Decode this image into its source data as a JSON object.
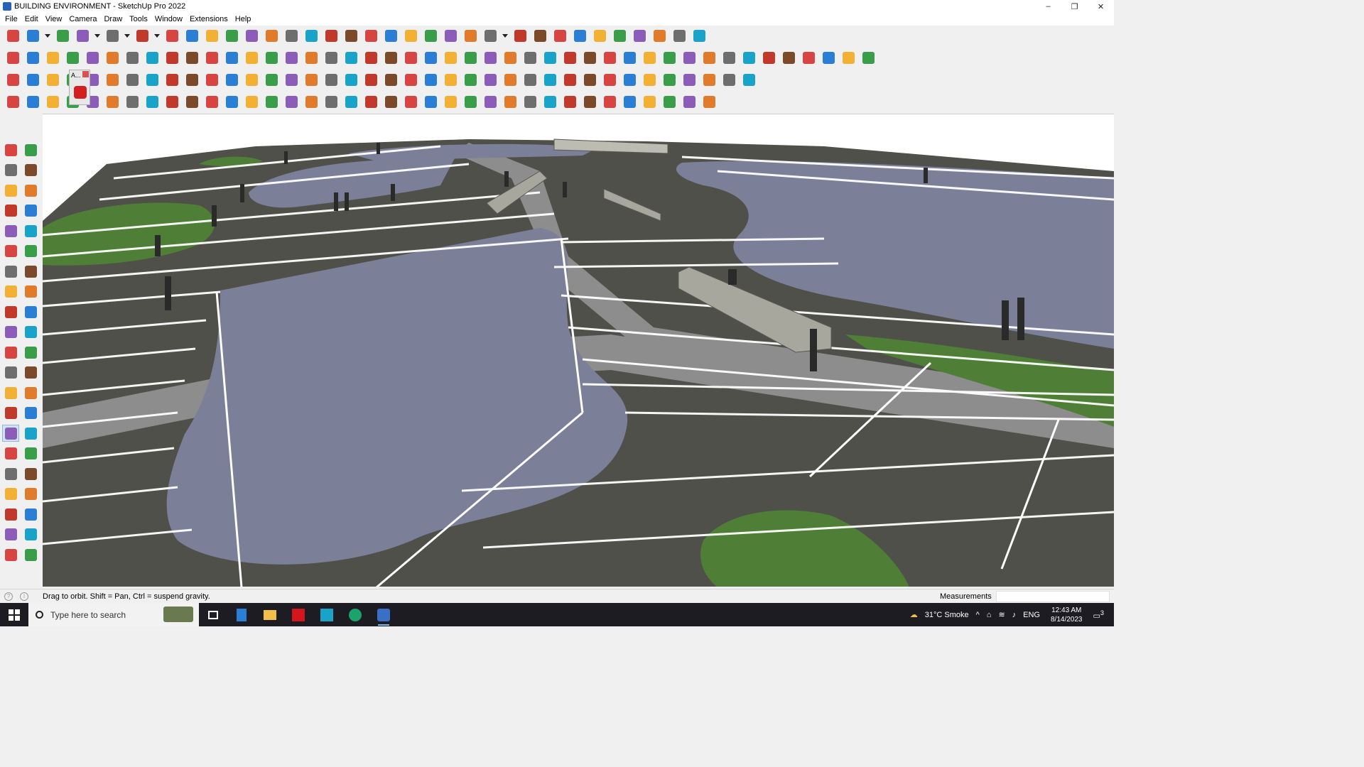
{
  "window": {
    "title": "BUILDING ENVIRONMENT - SketchUp Pro 2022",
    "minimize": "–",
    "restore": "❐",
    "close": "✕"
  },
  "menu": [
    "File",
    "Edit",
    "View",
    "Camera",
    "Draw",
    "Tools",
    "Window",
    "Extensions",
    "Help"
  ],
  "toolbars": {
    "row1_icons": [
      "zoom-tool",
      "select-tool",
      "dropdown",
      "eraser-tool",
      "pencil-line-tool",
      "dropdown",
      "freehand-tool",
      "dropdown",
      "rectangle-tool",
      "dropdown",
      "push-pull-tool",
      "follow-me-tool",
      "move-tool",
      "rotate-tool",
      "scale-tool",
      "tape-measure-tool",
      "text-tool",
      "paint-bucket-tool",
      "orbit-tool",
      "pan-tool",
      "zoom-tool",
      "zoom-extents-tool",
      "sandbox-from-contours",
      "sandbox-smoove",
      "sandbox-stamp",
      "sandbox-drape",
      "styles-tool",
      "dropdown",
      "component-tool",
      "group-tool",
      "axis-tool",
      "move-up",
      "move-down",
      "dimension-tool",
      "section-plane",
      "undo",
      "redo",
      "extension-tool"
    ],
    "row2_icons": [
      "iso-view",
      "top-view",
      "front-view",
      "push-pull-red",
      "arrow-down",
      "arrow-down-blue",
      "arrow-down-r",
      "arrow-down-v",
      "arrow-down-n",
      "arrow-down-x",
      "arrow-down-f",
      "curve-tool",
      "section-cut-1",
      "section-cut-2",
      "section-cut-3",
      "terrain-tool",
      "terrain-drape",
      "house-3d",
      "door-tool",
      "house-outline",
      "window-tool",
      "roof-tool",
      "font-tool",
      "eraser-soft",
      "pencil-red",
      "shape-rect",
      "shape-circle",
      "shape-hexagon",
      "shape-ellipse",
      "shape-parallelogram",
      "shape-arc",
      "shape-freehand",
      "shape-lasso",
      "shape-cloud",
      "shape-spiral",
      "laser-tool",
      "brush-tool",
      "material-a",
      "material-b",
      "material-c",
      "material-d",
      "material-e",
      "material-f",
      "material-g"
    ],
    "row3_icons": [
      "layers-blue",
      "layers-cyan",
      "layers-yellow",
      "tag-tool",
      "plane-tool",
      "rotate-orange",
      "square-red",
      "frame-tool",
      "bookmark-tool",
      "box-tool",
      "link-tool",
      "arc-tool",
      "dotted-line",
      "plus-red",
      "plus-green",
      "cross-blue",
      "cone-tool",
      "bucket-tool",
      "triangle-tool",
      "curve-yellow",
      "spiral-tool",
      "loop-tool",
      "move-blue",
      "box-brown",
      "magnet-tool",
      "grid-green",
      "paint-tool",
      "merge-tool",
      "explode-tool",
      "gem-tool",
      "cube-array",
      "box-flat",
      "grid-orange",
      "grid-square",
      "grid-dense",
      "dots-red",
      "curve-dots",
      "array-tool"
    ],
    "row4_icons": [
      "smart-select",
      "dashed-curve",
      "paint-red",
      "outline-tool",
      "tube-tool",
      "sweep-tool",
      "box-outline",
      "globe-tool",
      "bend-tool",
      "corner-1",
      "corner-2",
      "angle-tool",
      "fillet-tool",
      "building-tool",
      "slice-tool",
      "column-tool",
      "fan-tool",
      "hand-tool",
      "extrude-tool",
      "pyramid-tool",
      "stack-tool",
      "hatch-1",
      "hatch-2",
      "hatch-3",
      "block-tool",
      "hatch-4",
      "cube-flip",
      "mesh-tool",
      "texture-tool",
      "pattern-1",
      "pattern-2",
      "sphere-tool",
      "pattern-3",
      "pattern-4",
      "pattern-5",
      "star-tool"
    ],
    "layer_popup_label": "A..."
  },
  "left_toolbar_icons": [
    "select-arrow",
    "orbit-component",
    "paint-bucket",
    "eraser",
    "make-component",
    "tape-measure",
    "pencil",
    "freehand",
    "rectangle",
    "rotated-rectangle",
    "circle",
    "polygon",
    "arc",
    "two-point-arc",
    "pie",
    "three-point-arc",
    "move",
    "push-pull",
    "rotate",
    "follow-me",
    "scale",
    "offset",
    "tape",
    "dimension",
    "protractor",
    "text",
    "axes",
    "3d-text",
    "orbit",
    "pan",
    "zoom",
    "zoom-window",
    "zoom-extents",
    "previous-view",
    "position-camera",
    "look-around",
    "walk",
    "section-plane",
    "sandbox-1",
    "sandbox-2",
    "sandbox-3",
    "sandbox-4"
  ],
  "status": {
    "hint": "Drag to orbit.  Shift = Pan, Ctrl = suspend gravity.",
    "measurements_label": "Measurements",
    "measurements_value": ""
  },
  "taskbar": {
    "search_placeholder": "Type here to search",
    "weather": "31°C  Smoke",
    "language": "ENG",
    "time": "12:43 AM",
    "date": "8/14/2023",
    "notifications": "3"
  },
  "colors": {
    "water": "#7b7f98",
    "pavement_dark": "#4f4f45",
    "pavement_light": "#9a9a9a",
    "grass": "#4f7f36",
    "stripe": "#ffffff",
    "taskbar": "#1c1c22",
    "chrome": "#f0f0f0"
  }
}
